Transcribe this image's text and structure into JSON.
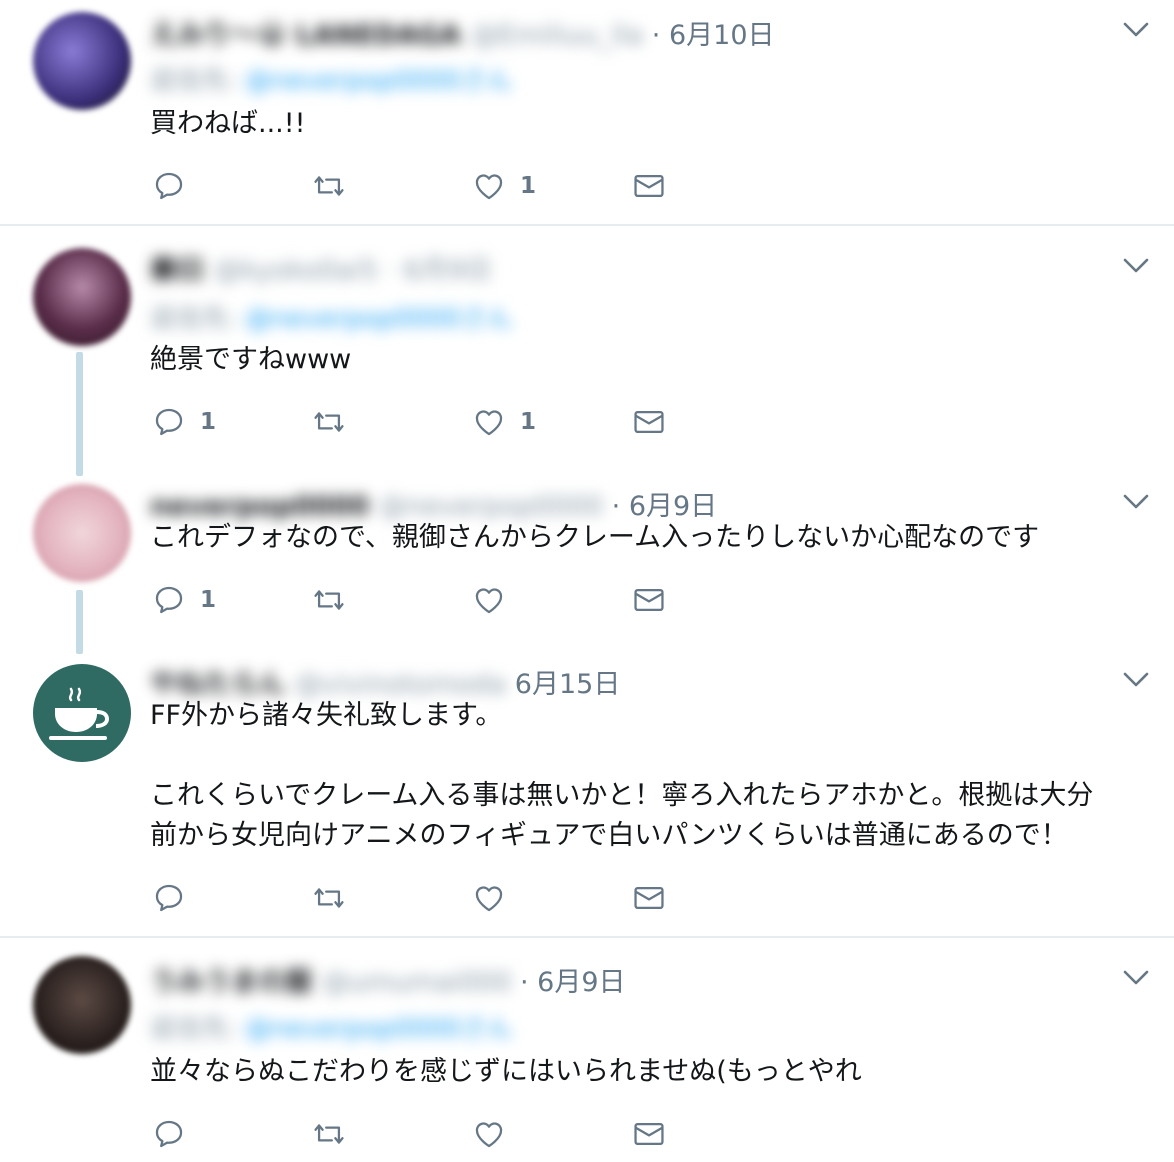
{
  "tweets": [
    {
      "name": "えみり〜😀 LANEDAGA",
      "handle": "@Emiliuu_lla",
      "date": "· 6月10日",
      "reply_to_label": "返信先:",
      "reply_to_handle": "@neverpop0000さん",
      "text": "買わねば...!!",
      "reply_count": "",
      "retweet_count": "",
      "like_count": "1"
    },
    {
      "name": "秦曰",
      "handle": "@kyoko0ai5 · 6月9日",
      "date": "",
      "reply_to_label": "返信先:",
      "reply_to_handle": "@neverpop0000さん",
      "text": "絶景ですねwww",
      "reply_count": "1",
      "retweet_count": "",
      "like_count": "1"
    },
    {
      "name": "neverpop0000",
      "handle": "@neverpop0000",
      "date": "· 6月9日",
      "text": "これデフォなので、親御さんからクレーム入ったりしないか心配なのです",
      "reply_count": "1",
      "retweet_count": "",
      "like_count": ""
    },
    {
      "name": "やねたらん",
      "handle": "@vivinotomoda",
      "date": "6月15日",
      "text": "FF外から諸々失礼致します。\n\nこれくらいでクレーム入る事は無いかと！寧ろ入れたらアホかと。根拠は大分\n前から女児向けアニメのフィギュアで白いパンツくらいは普通にあるので！",
      "reply_count": "",
      "retweet_count": "",
      "like_count": ""
    },
    {
      "name": "うみうまの服",
      "handle": "@umumai000",
      "date": "· 6月9日",
      "reply_to_label": "返信先:",
      "reply_to_handle": "@neverpop0000さん",
      "text": "並々ならぬこだわりを感じずにはいられませぬ(もっとやれ",
      "reply_count": "",
      "retweet_count": "",
      "like_count": ""
    }
  ],
  "icons": {
    "reply": "reply-icon",
    "retweet": "retweet-icon",
    "like": "heart-icon",
    "dm": "envelope-icon",
    "more": "chevron-down-icon"
  },
  "colors": {
    "icon_gray": "#657786",
    "link_blue": "#1da1f2",
    "thread_line": "#c4dbe6",
    "divider": "#e6ecf0"
  }
}
